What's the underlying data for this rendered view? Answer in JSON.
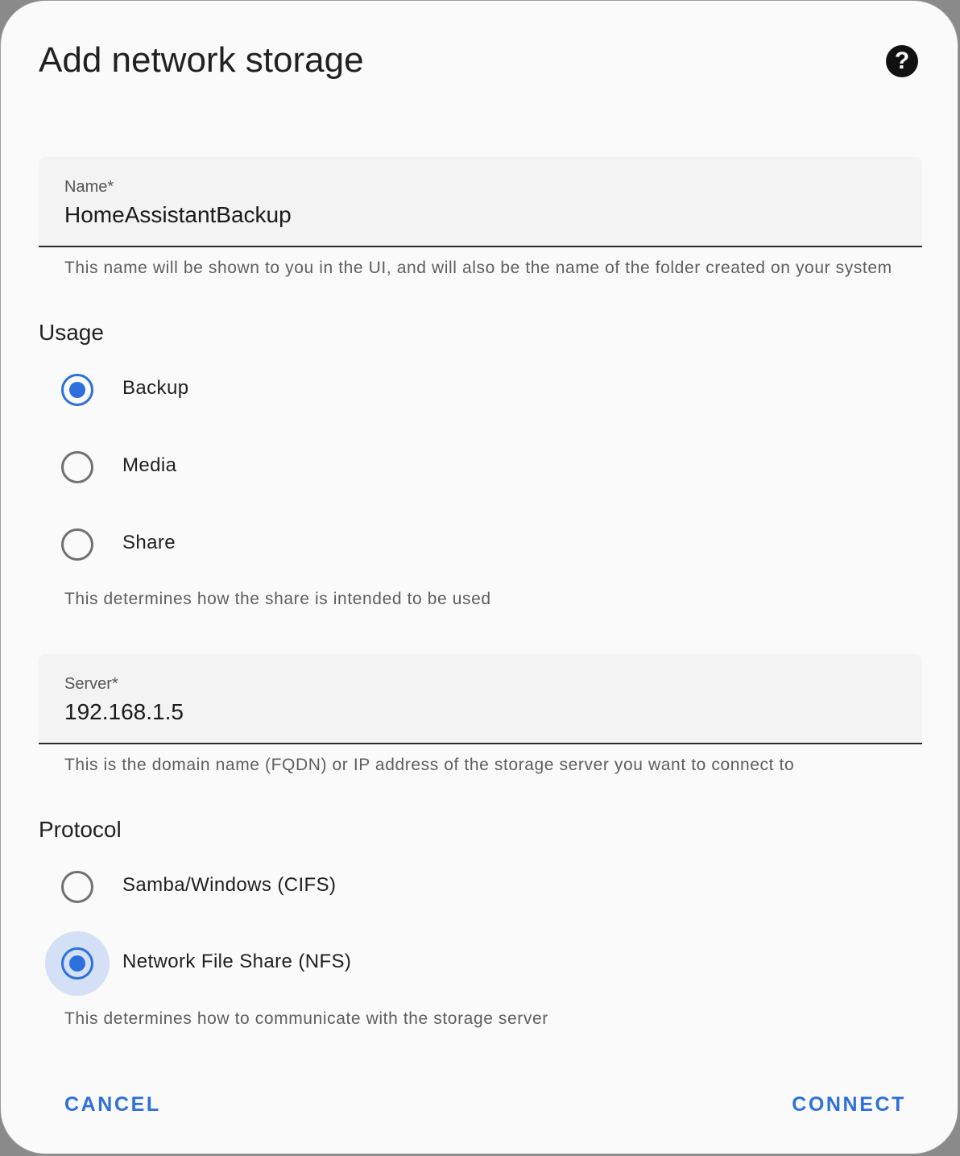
{
  "dialog": {
    "title": "Add network storage",
    "help_icon": "?"
  },
  "name_field": {
    "label": "Name*",
    "value": "HomeAssistantBackup",
    "helper": "This name will be shown to you in the UI, and will also be the name of the folder created on your system"
  },
  "usage": {
    "heading": "Usage",
    "options": [
      {
        "label": "Backup",
        "checked": true
      },
      {
        "label": "Media",
        "checked": false
      },
      {
        "label": "Share",
        "checked": false
      }
    ],
    "helper": "This determines how the share is intended to be used"
  },
  "server_field": {
    "label": "Server*",
    "value": "192.168.1.5",
    "helper": "This is the domain name (FQDN) or IP address of the storage server you want to connect to"
  },
  "protocol": {
    "heading": "Protocol",
    "options": [
      {
        "label": "Samba/Windows (CIFS)",
        "checked": false
      },
      {
        "label": "Network File Share (NFS)",
        "checked": true
      }
    ],
    "helper": "This determines how to communicate with the storage server"
  },
  "actions": {
    "cancel_label": "CANCEL",
    "connect_label": "CONNECT"
  },
  "colors": {
    "accent": "#2d6fdb",
    "focus_halo": "#d3e0f6"
  }
}
